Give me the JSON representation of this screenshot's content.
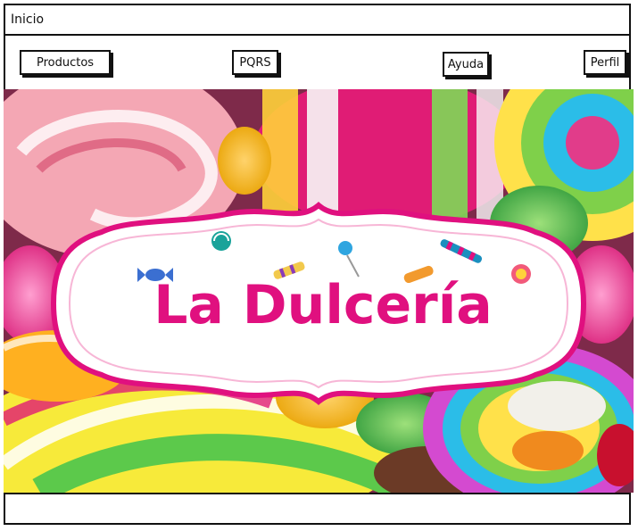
{
  "window": {
    "title": "Inicio"
  },
  "nav": {
    "productos": "Productos",
    "pqrs": "PQRS",
    "ayuda": "Ayuda",
    "perfil": "Perfil"
  },
  "hero": {
    "brand": "La Dulcería",
    "colors": {
      "brand_pink": "#e0107f",
      "sign_bg": "#ffffff"
    }
  }
}
